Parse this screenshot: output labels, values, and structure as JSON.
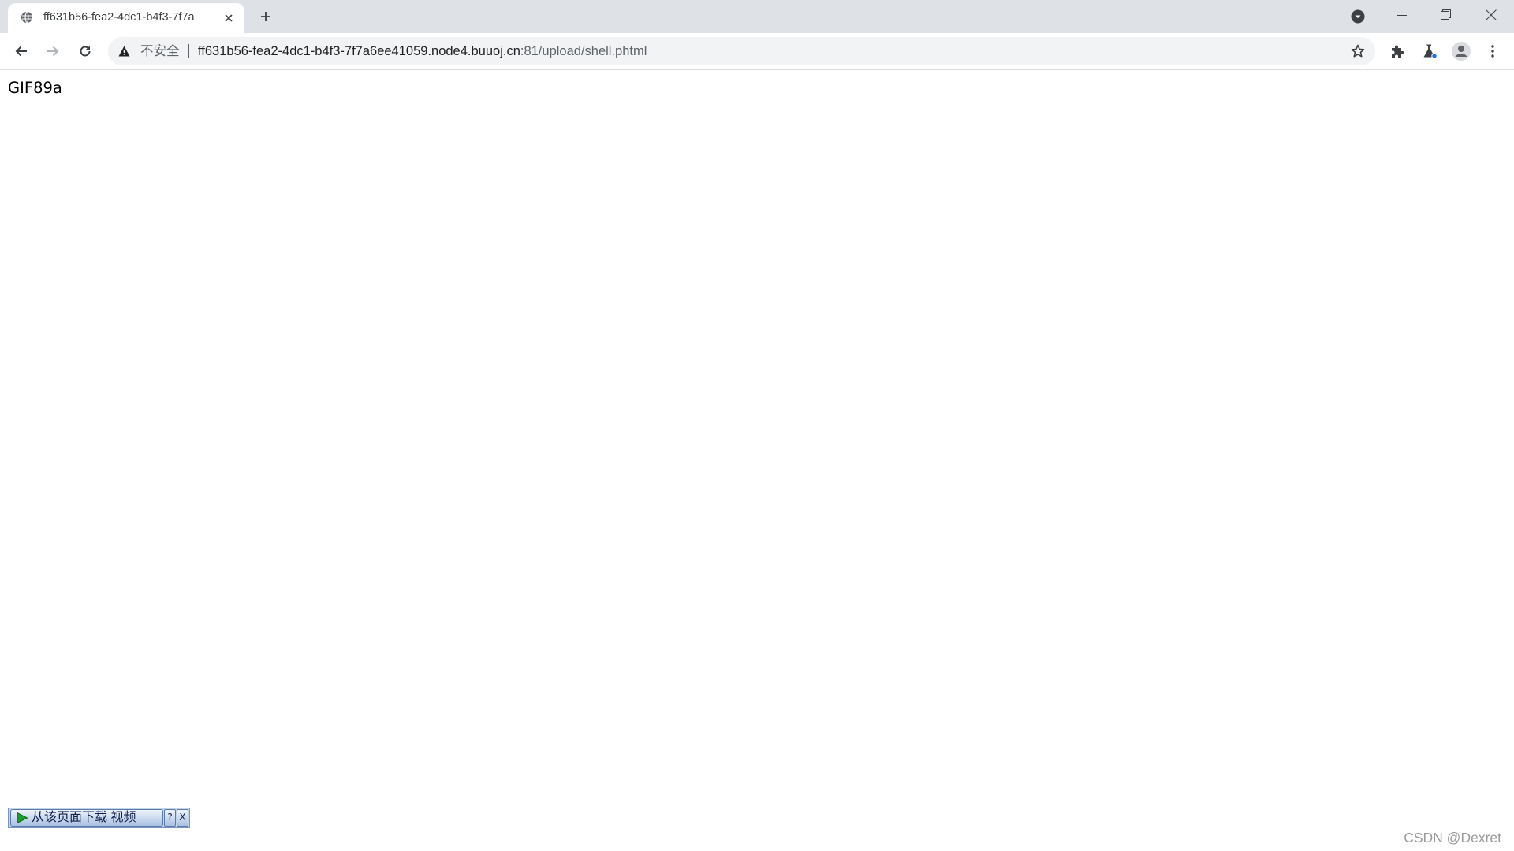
{
  "window": {
    "tab": {
      "title": "ff631b56-fea2-4dc1-b4f3-7f7a",
      "favicon": "globe-icon"
    },
    "controls": [
      "tab-search-icon",
      "minimize-icon",
      "restore-icon",
      "close-icon"
    ]
  },
  "toolbar": {
    "nav_icons": [
      "back-arrow-icon",
      "forward-arrow-icon",
      "reload-icon"
    ],
    "security_label": "不安全",
    "url_host": "ff631b56-fea2-4dc1-b4f3-7f7a6ee41059.node4.buuoj.cn",
    "url_path": ":81/upload/shell.phtml",
    "action_icons": [
      "bookmark-star-icon",
      "extensions-puzzle-icon",
      "labs-flask-icon",
      "profile-avatar-icon",
      "menu-kebab-icon"
    ]
  },
  "page": {
    "text": "GIF89a"
  },
  "download_bar": {
    "label": "从该页面下载 视频",
    "help_label": "?",
    "close_label": "X"
  },
  "watermark": {
    "text": "CSDN @Dexret"
  },
  "colors": {
    "tabstrip_bg": "#dee1e6",
    "omnibox_bg": "#f1f3f4",
    "text_primary": "#202124",
    "text_secondary": "#5f6368",
    "labs_dot": "#1a73e8",
    "download_play": "#1a9e2a"
  }
}
